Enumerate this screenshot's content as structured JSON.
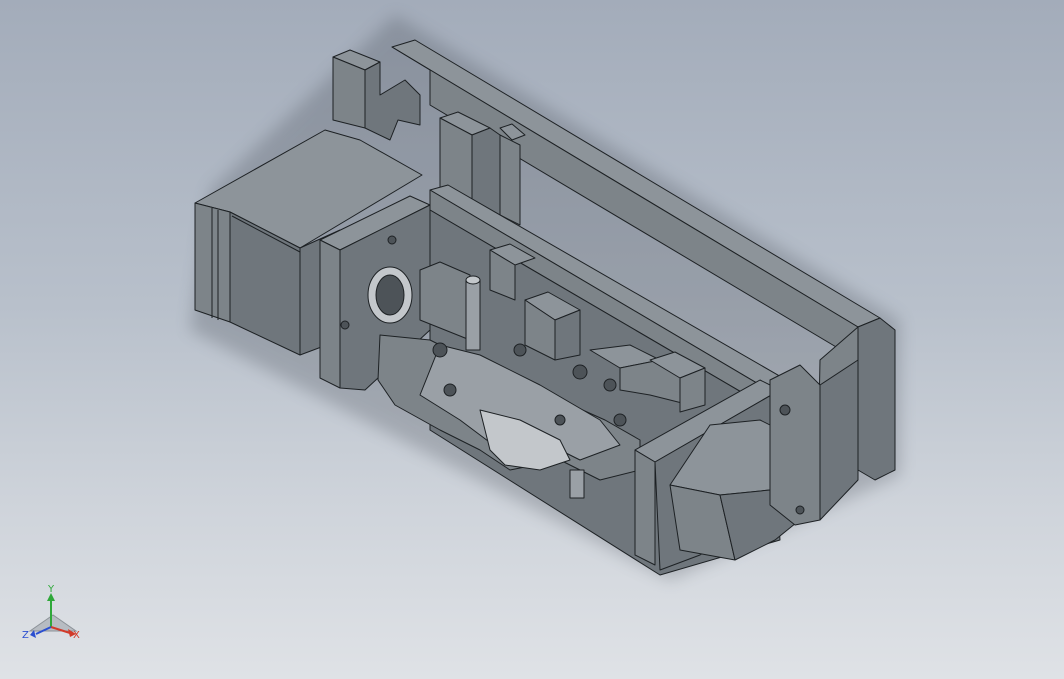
{
  "viewport": {
    "background_top": "#a3acba",
    "background_bottom": "#dfe2e6",
    "model_color": "#7d8489",
    "edge_color": "#1d2124"
  },
  "triad": {
    "x_label": "X",
    "y_label": "Y",
    "z_label": "Z",
    "x_color": "#d23a2a",
    "y_color": "#2fa83a",
    "z_color": "#2b4fd0"
  }
}
